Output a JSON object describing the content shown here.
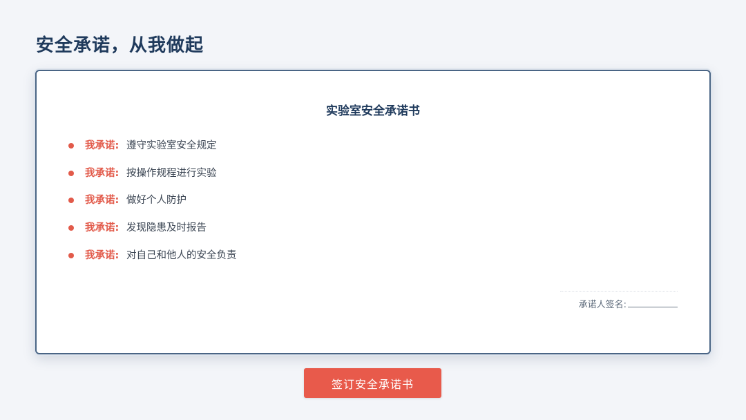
{
  "page": {
    "title": "安全承诺，从我做起"
  },
  "card": {
    "title": "实验室安全承诺书",
    "pledges": [
      {
        "prefix": "我承诺:",
        "text": "遵守实验室安全规定"
      },
      {
        "prefix": "我承诺:",
        "text": "按操作规程进行实验"
      },
      {
        "prefix": "我承诺:",
        "text": "做好个人防护"
      },
      {
        "prefix": "我承诺:",
        "text": "发现隐患及时报告"
      },
      {
        "prefix": "我承诺:",
        "text": "对自己和他人的安全负责"
      }
    ],
    "signature_label": "承诺人签名:"
  },
  "actions": {
    "sign_button_label": "签订安全承诺书"
  },
  "colors": {
    "accent": "#e85a4b",
    "title": "#1f3a5c",
    "background": "#f3f5f9"
  }
}
